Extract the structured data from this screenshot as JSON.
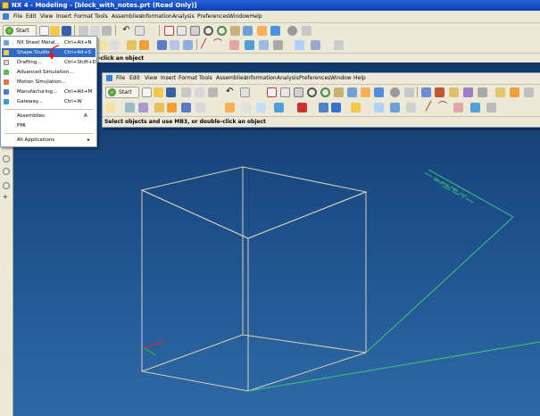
{
  "window": {
    "title": "NX 4 - Modeling - [block_with_notes.prt (Read Only)]"
  },
  "menu": {
    "items": [
      "File",
      "Edit",
      "View",
      "Insert",
      "Format",
      "Tools",
      "Assemblies",
      "Information",
      "Analysis",
      "Preferences",
      "Window",
      "Help"
    ]
  },
  "toolbar": {
    "start_label": "Start",
    "cue_text": "-click an object"
  },
  "start_menu": {
    "items": [
      {
        "label": "NX Sheet Metal...",
        "shortcut": "Ctrl+Alt+N"
      },
      {
        "label": "Shape Studio",
        "shortcut": "Ctrl+Alt+S"
      },
      {
        "label": "Drafting...",
        "shortcut": "Ctrl+Shift+D"
      },
      {
        "label": "Advanced Simulation...",
        "shortcut": ""
      },
      {
        "label": "Motion Simulation...",
        "shortcut": ""
      },
      {
        "label": "Manufacturing...",
        "shortcut": "Ctrl+Alt+M"
      },
      {
        "label": "Gateway...",
        "shortcut": "Ctrl+W"
      }
    ],
    "assemblies_label": "Assemblies",
    "assemblies_shortcut": "A",
    "pmi_label": "PMI",
    "all_apps_label": "All Applications",
    "submenu_arrow": "▸"
  },
  "popup": {
    "menu_items": [
      "File",
      "Edit",
      "View",
      "Insert",
      "Format",
      "Tools",
      "Assemblies",
      "Information",
      "Analysis",
      "Preferences",
      "Window",
      "Help"
    ],
    "start_label": "Start",
    "cue_text": "Select objects and use MB3, or double-click an object"
  },
  "colors": {
    "titlebar": "#0a3fb8",
    "selection": "#316ac5",
    "arrow": "#e31b1b",
    "wireframe": "#d9d0b8",
    "note_text": "#38c97a"
  }
}
